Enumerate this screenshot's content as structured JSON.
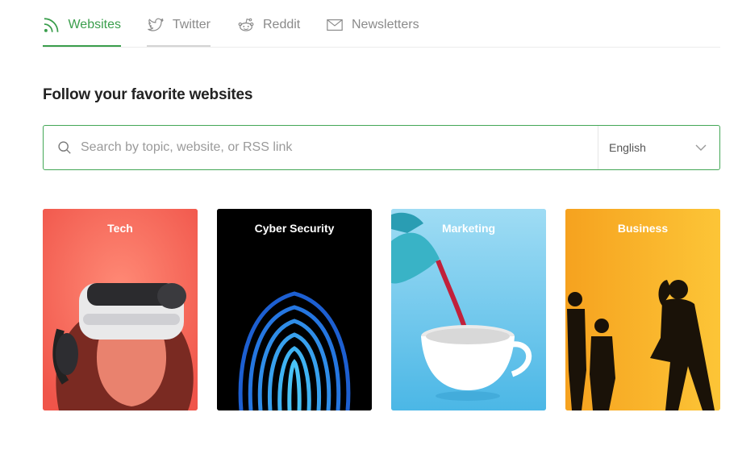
{
  "tabs": [
    {
      "label": "Websites",
      "icon": "rss-icon",
      "active": true
    },
    {
      "label": "Twitter",
      "icon": "twitter-icon",
      "active": false
    },
    {
      "label": "Reddit",
      "icon": "reddit-icon",
      "active": false
    },
    {
      "label": "Newsletters",
      "icon": "envelope-icon",
      "active": false
    }
  ],
  "heading": "Follow your favorite websites",
  "search": {
    "placeholder": "Search by topic, website, or RSS link",
    "language": "English"
  },
  "categories": [
    {
      "title": "Tech"
    },
    {
      "title": "Cyber Security"
    },
    {
      "title": "Marketing"
    },
    {
      "title": "Business"
    }
  ],
  "colors": {
    "accent": "#3a9e4c",
    "tech": "#f76a5a",
    "cyber": "#000000",
    "marketing": "#7fd0ef",
    "business": "#f8b328"
  }
}
